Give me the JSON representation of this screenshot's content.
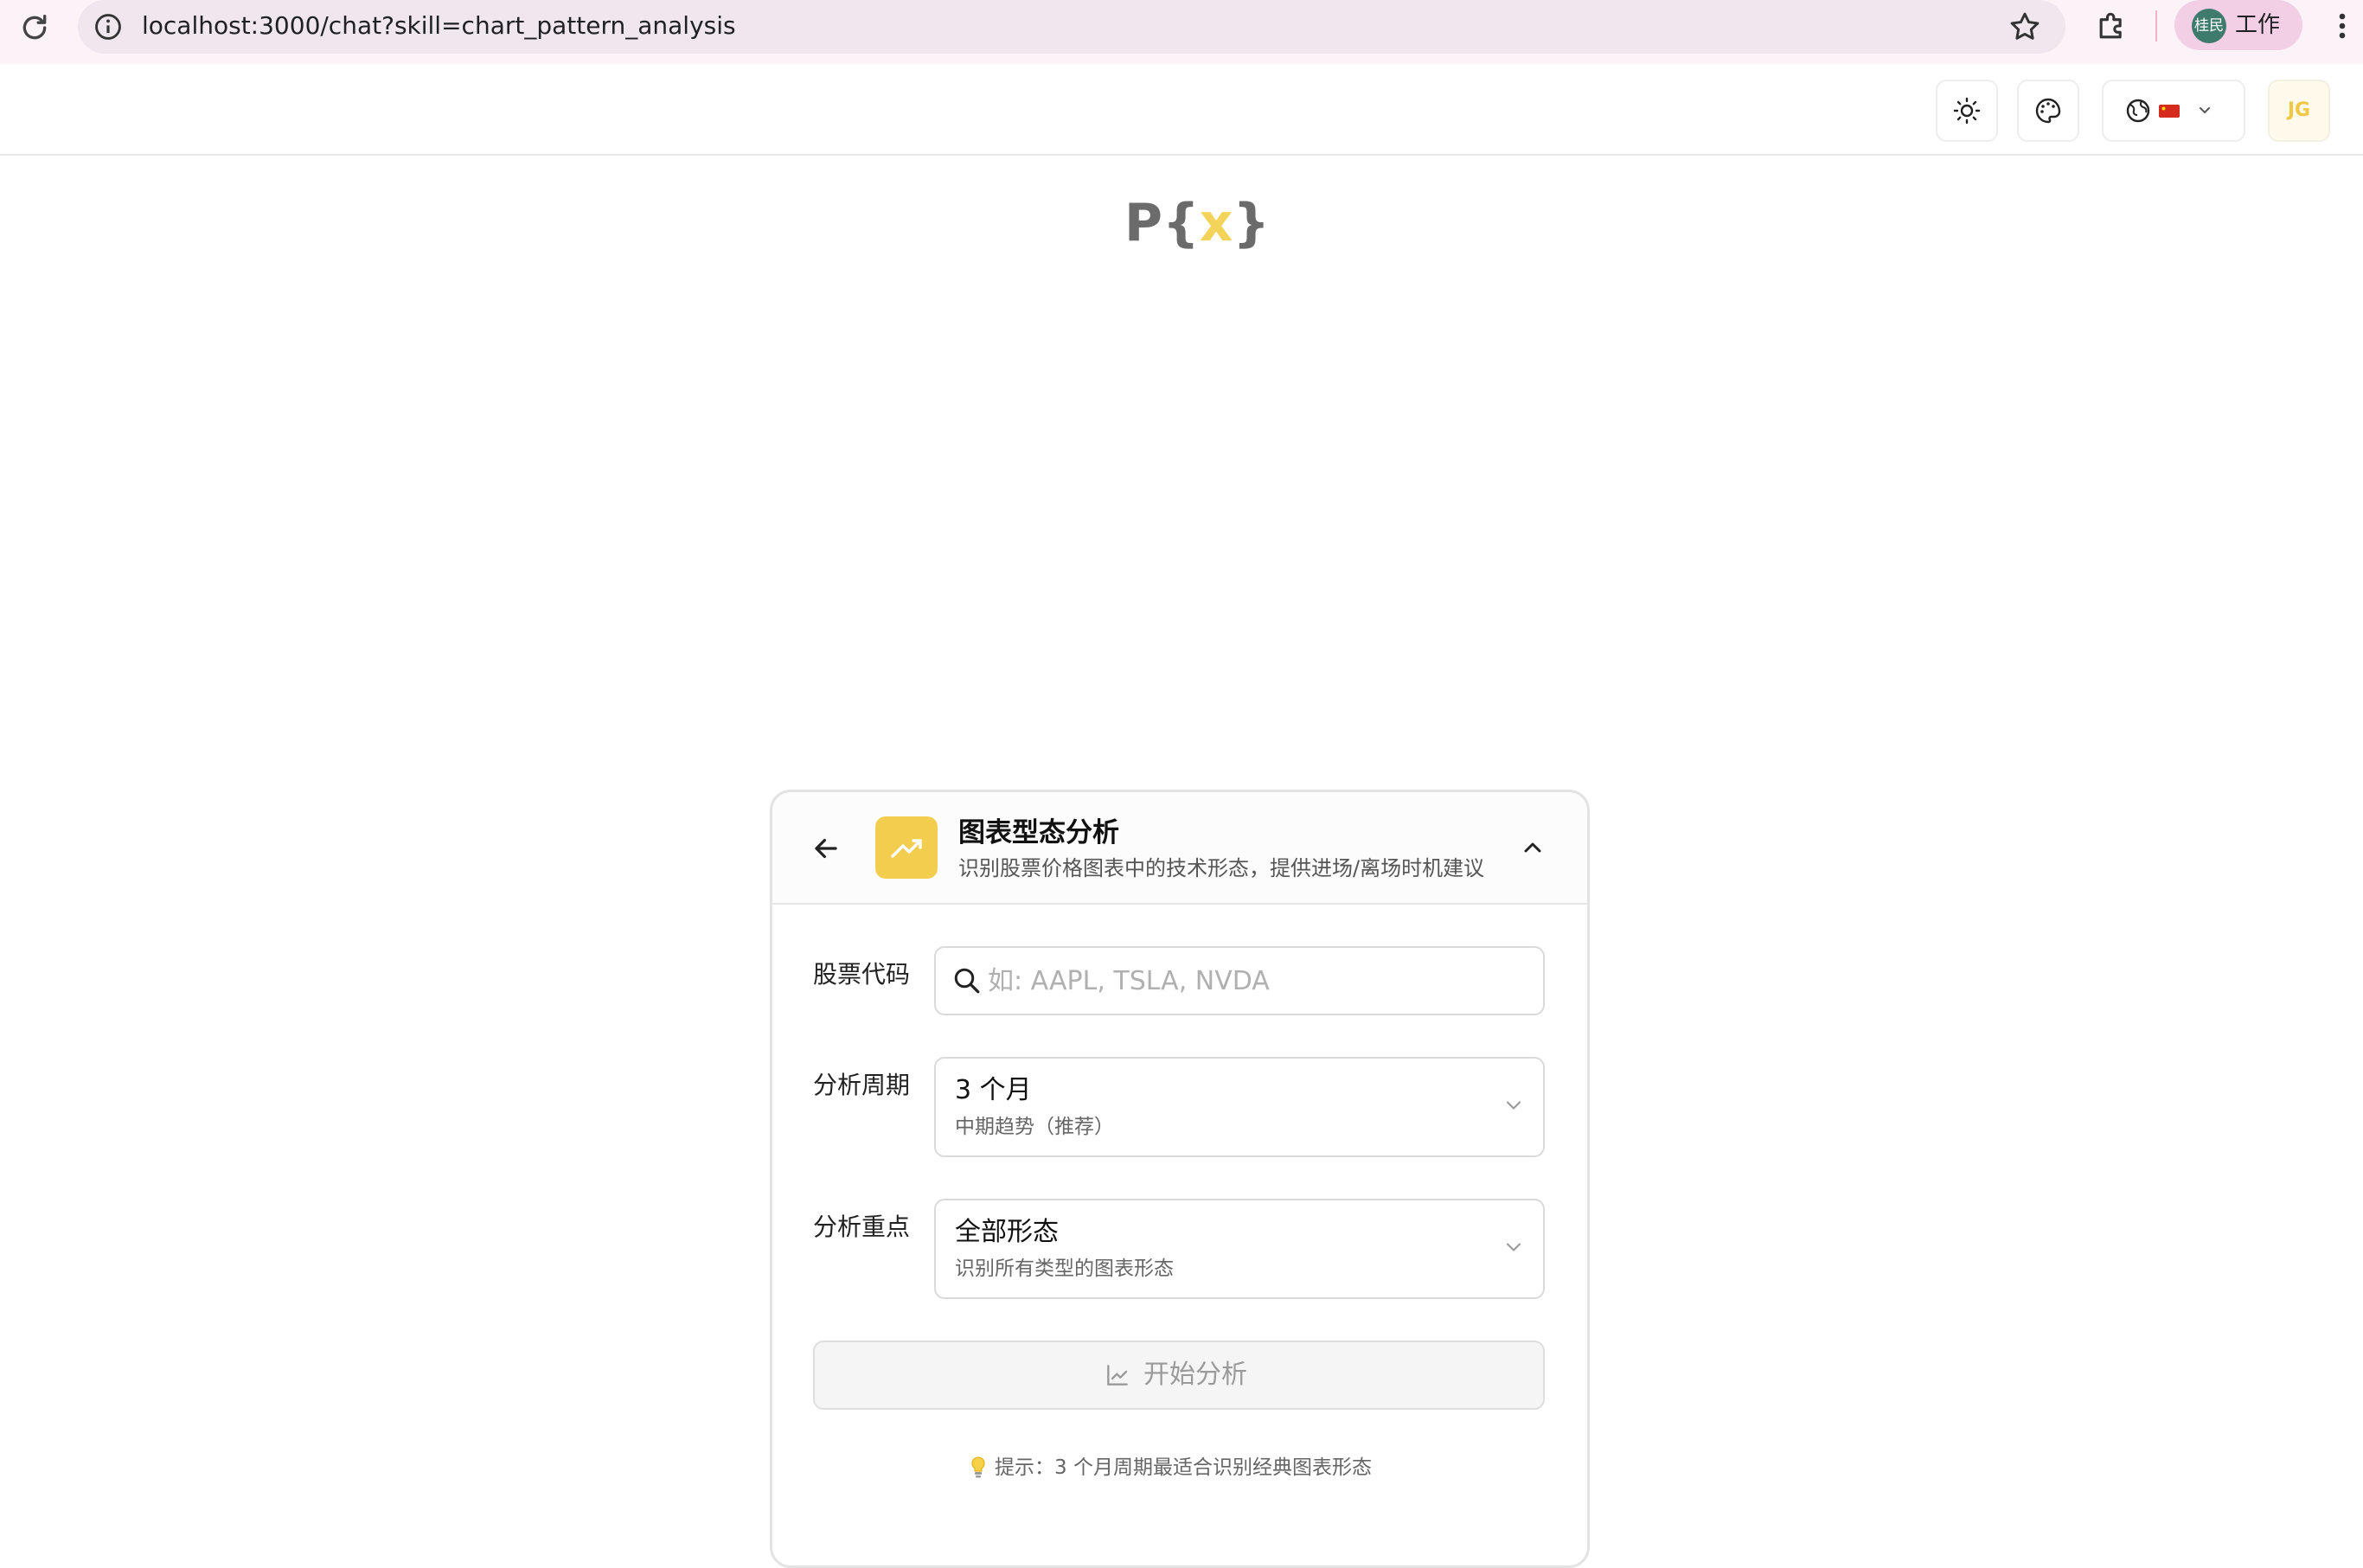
{
  "browser": {
    "url": "localhost:3000/chat?skill=chart_pattern_analysis",
    "profile_avatar_text": "桂民",
    "profile_name": "工作",
    "icons": [
      "reload-icon",
      "site-info-icon",
      "bookmark-star-icon",
      "extensions-icon",
      "more-menu-icon"
    ]
  },
  "header": {
    "user_initials": "JG",
    "icons": [
      "sun-icon",
      "palette-icon",
      "globe-icon",
      "flag-cn-icon",
      "chevron-down-icon"
    ]
  },
  "logo": {
    "p": "P",
    "open": "{",
    "x": "x",
    "close": "}"
  },
  "skill": {
    "title": "图表型态分析",
    "subtitle": "识别股票价格图表中的技术形态，提供进场/离场时机建议",
    "icon": "trending-up-icon"
  },
  "form": {
    "ticker_label": "股票代码",
    "ticker_placeholder": "如: AAPL, TSLA, NVDA",
    "ticker_value": "",
    "period_label": "分析周期",
    "period_value": "3 个月",
    "period_desc": "中期趋势（推荐）",
    "focus_label": "分析重点",
    "focus_value": "全部形态",
    "focus_desc": "识别所有类型的图表形态",
    "start_label": "开始分析",
    "hint": "提示：3 个月周期最适合识别经典图表形态"
  },
  "colors": {
    "accent_yellow": "#f3cd4e",
    "logo_gray": "#6b6b6b",
    "browser_bg": "#fbf3f8",
    "profile_pill": "#f3cfe6"
  }
}
